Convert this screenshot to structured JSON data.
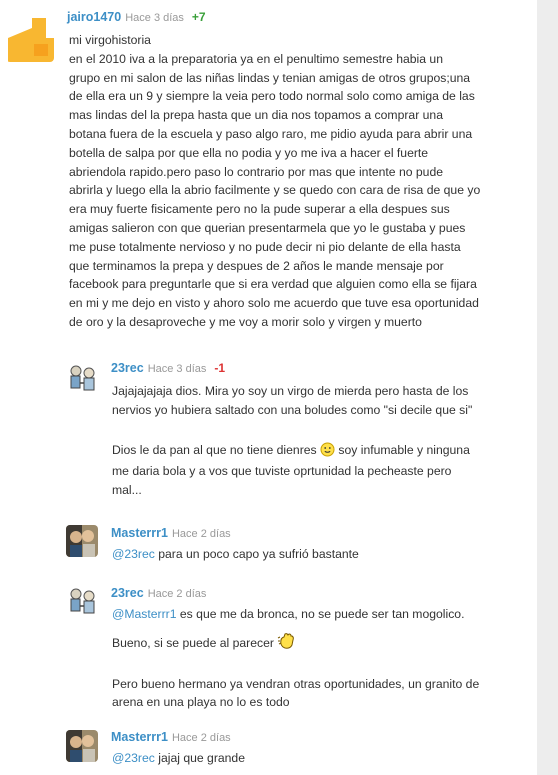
{
  "comments": [
    {
      "user": "jairo1470",
      "time": "Hace 3 días",
      "votes": "+7",
      "lines": [
        "mi virgohistoria",
        "en el 2010 iva a la preparatoria ya en el penultimo semestre habia un",
        "grupo en mi salon de las niñas lindas y tenian amigas de otros grupos;una",
        "de ella era un 9 y siempre la veia pero todo normal solo como amiga de las",
        "mas lindas del la prepa hasta que un dia nos topamos a comprar una",
        "botana fuera de la escuela y paso algo raro, me pidio ayuda para abrir una",
        "botella de salpa por que ella no podia y yo me iva a hacer el fuerte",
        "abriendola rapido.pero paso lo contrario por mas que intente no pude",
        "abrirla y luego ella la abrio facilmente y se quedo con cara de risa de que yo",
        "era muy fuerte fisicamente pero no la pude superar a ella despues sus",
        "amigas salieron con que querian presentarmela que yo le gustaba y pues",
        "me puse totalmente nervioso y no pude decir ni pio delante de ella hasta",
        "que terminamos la prepa y despues de 2 años le mande mensaje por",
        "facebook para preguntarle que si era verdad que alguien como ella se fijara",
        "en mi y me dejo en visto y ahoro solo me acuerdo que tuve esa oportunidad",
        "de oro y la desaproveche y me voy a morir solo y virgen y muerto"
      ]
    },
    {
      "user": "23rec",
      "time": "Hace 3 días",
      "votes": "-1",
      "lines": [
        "Jajajajajaja dios. Mira yo soy un virgo de mierda pero hasta de los",
        "nervios yo hubiera saltado con una boludes como \"si decile que si\"",
        "Dios le da pan al que no tiene dienres",
        "soy infumable y ninguna",
        "me daria bola y a vos que tuviste oprtunidad la pecheaste pero",
        "mal..."
      ]
    },
    {
      "user": "Masterrr1",
      "time": "Hace 2 días",
      "mention": "@23rec",
      "text": "para un poco capo ya sufrió bastante"
    },
    {
      "user": "23rec",
      "time": "Hace 2 días",
      "mention": "@Masterrr1",
      "text": "es que me da bronca, no se puede ser tan mogolico.",
      "lines": [
        "Bueno, si se puede al parecer",
        "Pero bueno hermano ya vendran otras oportunidades, un granito de",
        "arena en una playa no lo es todo"
      ]
    },
    {
      "user": "Masterrr1",
      "time": "Hace 2 días",
      "mention": "@23rec",
      "text": "jajaj que grande"
    }
  ],
  "colors": {
    "username": "#3d8fc6",
    "positive_vote": "#3aa03a",
    "negative_vote": "#d33333",
    "timestamp": "#999999"
  },
  "icons": {
    "emoticon_1": "smiley-face-icon",
    "emoticon_2": "waving-hand-icon"
  }
}
